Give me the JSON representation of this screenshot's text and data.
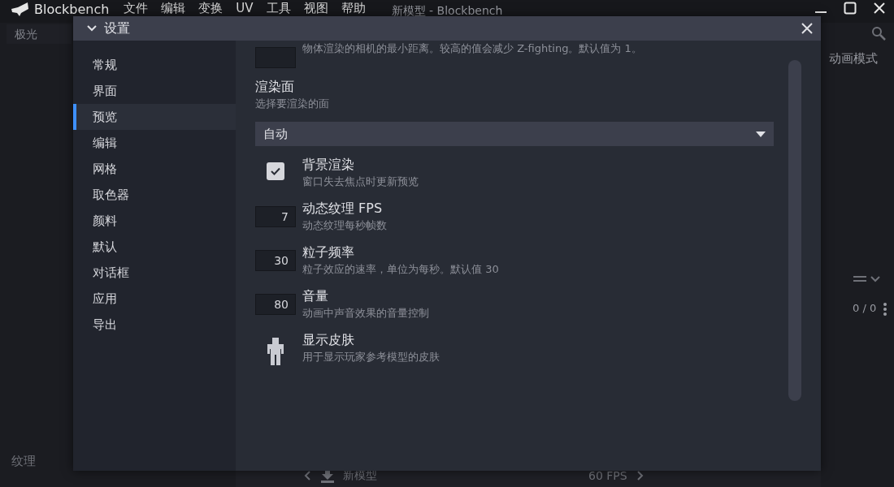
{
  "app": {
    "name": "Blockbench"
  },
  "menu": [
    "文件",
    "编辑",
    "变换",
    "UV",
    "工具",
    "视图",
    "帮助"
  ],
  "window": {
    "title": "新模型 - Blockbench"
  },
  "background": {
    "project_tab": "极光",
    "mode_tab": "动画模式",
    "counter": "0 / 0",
    "panel_title": "纹理",
    "status_bar": {
      "model_name": "新模型",
      "fps": "60 FPS"
    }
  },
  "dialog": {
    "title": "设置",
    "categories": [
      {
        "label": "常规",
        "selected": false
      },
      {
        "label": "界面",
        "selected": false
      },
      {
        "label": "预览",
        "selected": true
      },
      {
        "label": "编辑",
        "selected": false
      },
      {
        "label": "网格",
        "selected": false
      },
      {
        "label": "取色器",
        "selected": false
      },
      {
        "label": "颜料",
        "selected": false
      },
      {
        "label": "默认",
        "selected": false
      },
      {
        "label": "对话框",
        "selected": false
      },
      {
        "label": "应用",
        "selected": false
      },
      {
        "label": "导出",
        "selected": false
      }
    ],
    "settings": [
      {
        "kind": "number",
        "description": "物体渲染的相机的最小距离。较高的值会减少 Z-fighting。默认值为 1。"
      },
      {
        "kind": "select",
        "title": "渲染面",
        "description": "选择要渲染的面",
        "value": "自动"
      },
      {
        "kind": "checkbox",
        "title": "背景渲染",
        "description": "窗口失去焦点时更新预览",
        "checked": true
      },
      {
        "kind": "number",
        "title": "动态纹理 FPS",
        "description": "动态纹理每秒帧数",
        "value": "7"
      },
      {
        "kind": "number",
        "title": "粒子频率",
        "description": "粒子效应的速率，单位为每秒。默认值 30",
        "value": "30"
      },
      {
        "kind": "number",
        "title": "音量",
        "description": "动画中声音效果的音量控制",
        "value": "80"
      },
      {
        "kind": "button",
        "title": "显示皮肤",
        "description": "用于显示玩家参考模型的皮肤"
      }
    ]
  }
}
